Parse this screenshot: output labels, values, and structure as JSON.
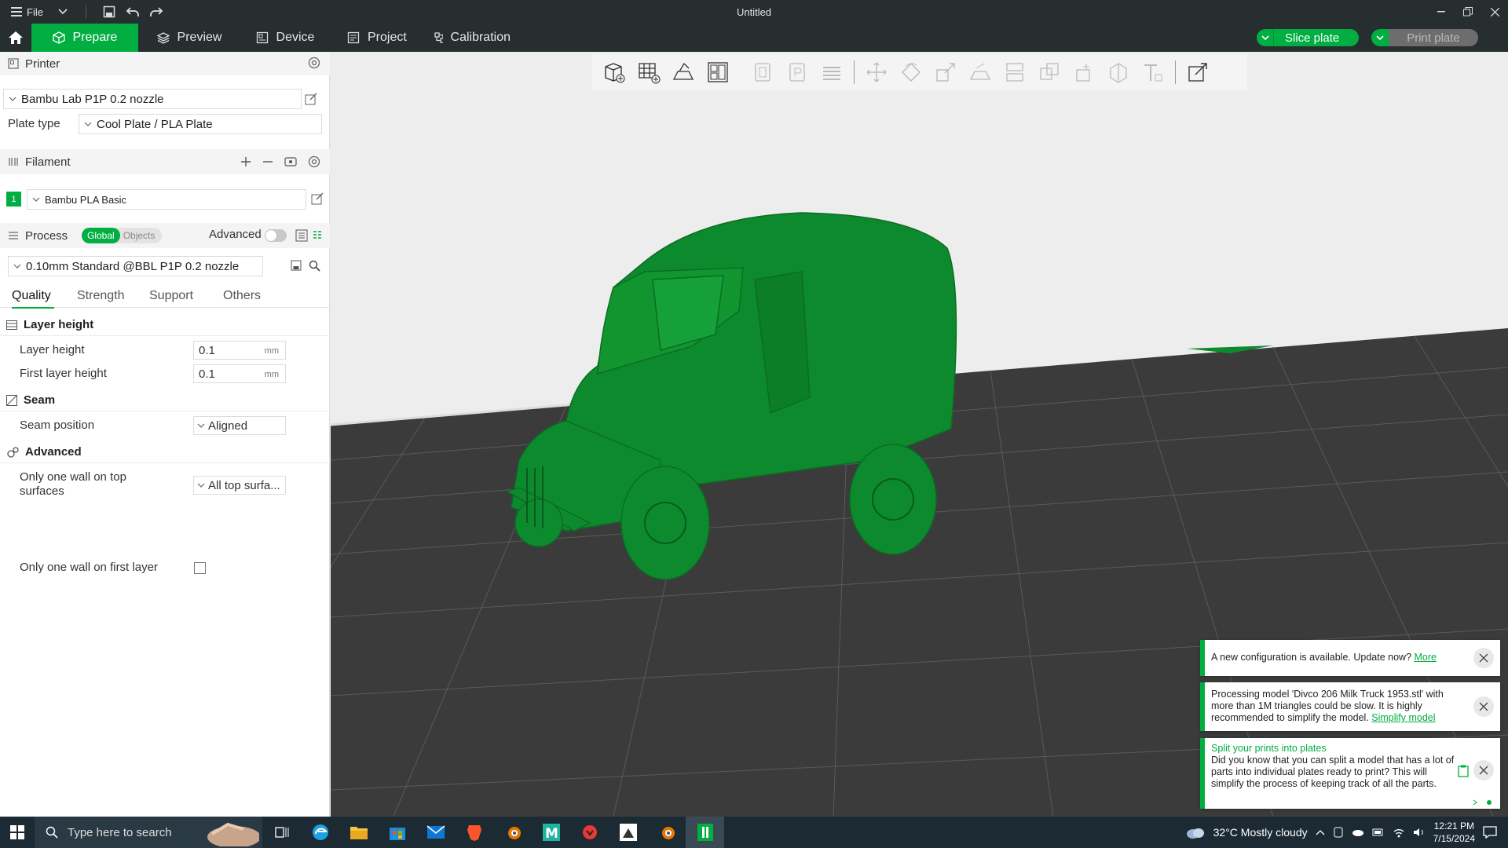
{
  "titlebar": {
    "file_label": "File",
    "title": "Untitled"
  },
  "nav": {
    "tabs": [
      {
        "label": "Prepare"
      },
      {
        "label": "Preview"
      },
      {
        "label": "Device"
      },
      {
        "label": "Project"
      },
      {
        "label": "Calibration"
      }
    ],
    "slice_label": "Slice plate",
    "print_label": "Print plate"
  },
  "printer": {
    "section_title": "Printer",
    "selected": "Bambu Lab P1P 0.2 nozzle",
    "plate_type_label": "Plate type",
    "plate_type": "Cool Plate / PLA Plate"
  },
  "filament": {
    "section_title": "Filament",
    "index": "1",
    "selected": "Bambu PLA Basic",
    "color": "#00ae42"
  },
  "process": {
    "section_title": "Process",
    "toggle_global": "Global",
    "toggle_objects": "Objects",
    "advanced_label": "Advanced",
    "preset": "0.10mm Standard @BBL P1P 0.2 nozzle",
    "tabs": [
      "Quality",
      "Strength",
      "Support",
      "Others"
    ],
    "groups": {
      "layer_height": {
        "title": "Layer height",
        "layer_height_label": "Layer height",
        "layer_height_value": "0.1",
        "first_layer_label": "First layer height",
        "first_layer_value": "0.1",
        "unit": "mm"
      },
      "seam": {
        "title": "Seam",
        "position_label": "Seam position",
        "position_value": "Aligned"
      },
      "advanced": {
        "title": "Advanced",
        "one_wall_top_label_1": "Only one wall on top",
        "one_wall_top_label_2": "surfaces",
        "one_wall_top_value": "All top surfa...",
        "one_wall_first_label": "Only one wall on first layer",
        "one_wall_first_checked": false
      }
    }
  },
  "notifications": [
    {
      "text": "A new configuration is available. Update now?",
      "link": "More"
    },
    {
      "text": "Processing model 'Divco 206 Milk Truck 1953.stl' with more than 1M triangles could be slow. It is highly recommended to simplify the model.",
      "link": "Simplify model"
    },
    {
      "title": "Split your prints into plates",
      "text": "Did you know that you can split a model that has a lot of parts into individual plates ready to print? This will simplify the process of keeping track of all the parts."
    }
  ],
  "taskbar": {
    "search_placeholder": "Type here to search",
    "weather": "32°C  Mostly cloudy",
    "time": "12:21 PM",
    "date": "7/15/2024"
  },
  "colors": {
    "accent": "#00ae42",
    "model": "#0e8a2e",
    "bed": "#3b3b3b"
  }
}
